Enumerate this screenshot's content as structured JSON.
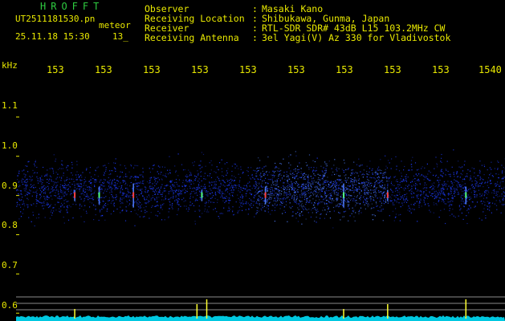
{
  "header": {
    "app_title": "HROFFT",
    "filename": "UT2511181530.pn",
    "type_label": "meteor",
    "datetime": "25.11.18 15:30",
    "count": "13_"
  },
  "station_info": [
    {
      "label": "Observer",
      "value": "Masaki Kano"
    },
    {
      "label": "Receiving Location",
      "value": "Shibukawa, Gunma, Japan"
    },
    {
      "label": "Receiver",
      "value": "RTL-SDR SDR# 43dB L15 103.2MHz CW"
    },
    {
      "label": "Receiving Antenna",
      "value": "3el Yagi(V) Az 330 for Vladivostok"
    }
  ],
  "chart_data": {
    "type": "heatmap",
    "y_unit": "kHz",
    "x_tick_labels": [
      "153",
      "153",
      "153",
      "153",
      "153",
      "153",
      "153",
      "153",
      "153",
      "1540"
    ],
    "y_tick_labels": [
      "1.1",
      "1.0",
      "0.9",
      "0.8",
      "0.7",
      "0.6"
    ],
    "y_ticks": [
      1.1,
      1.0,
      0.9,
      0.8,
      0.7,
      0.6
    ],
    "ylim": [
      0.58,
      1.2
    ],
    "noise_band_khz": [
      0.82,
      1.01
    ],
    "signal_center_khz": 0.9,
    "strong_segment_fraction": [
      0.49,
      0.76
    ],
    "colors": {
      "background": "#000000",
      "noise": "#1e3cff",
      "noise_strong": "#4f7dff",
      "meteor_hit": "#ff4040",
      "meteor_green": "#50ff80",
      "baseline": "#00c8e0",
      "peak": "#ffff30",
      "ticks": "#e8e800",
      "guide": "#b8b8b8"
    },
    "meteor_fractions": [
      0.12,
      0.17,
      0.24,
      0.38,
      0.51,
      0.67,
      0.76,
      0.92
    ],
    "peak_fractions": [
      0.12,
      0.37,
      0.39,
      0.67,
      0.76,
      0.92
    ]
  }
}
